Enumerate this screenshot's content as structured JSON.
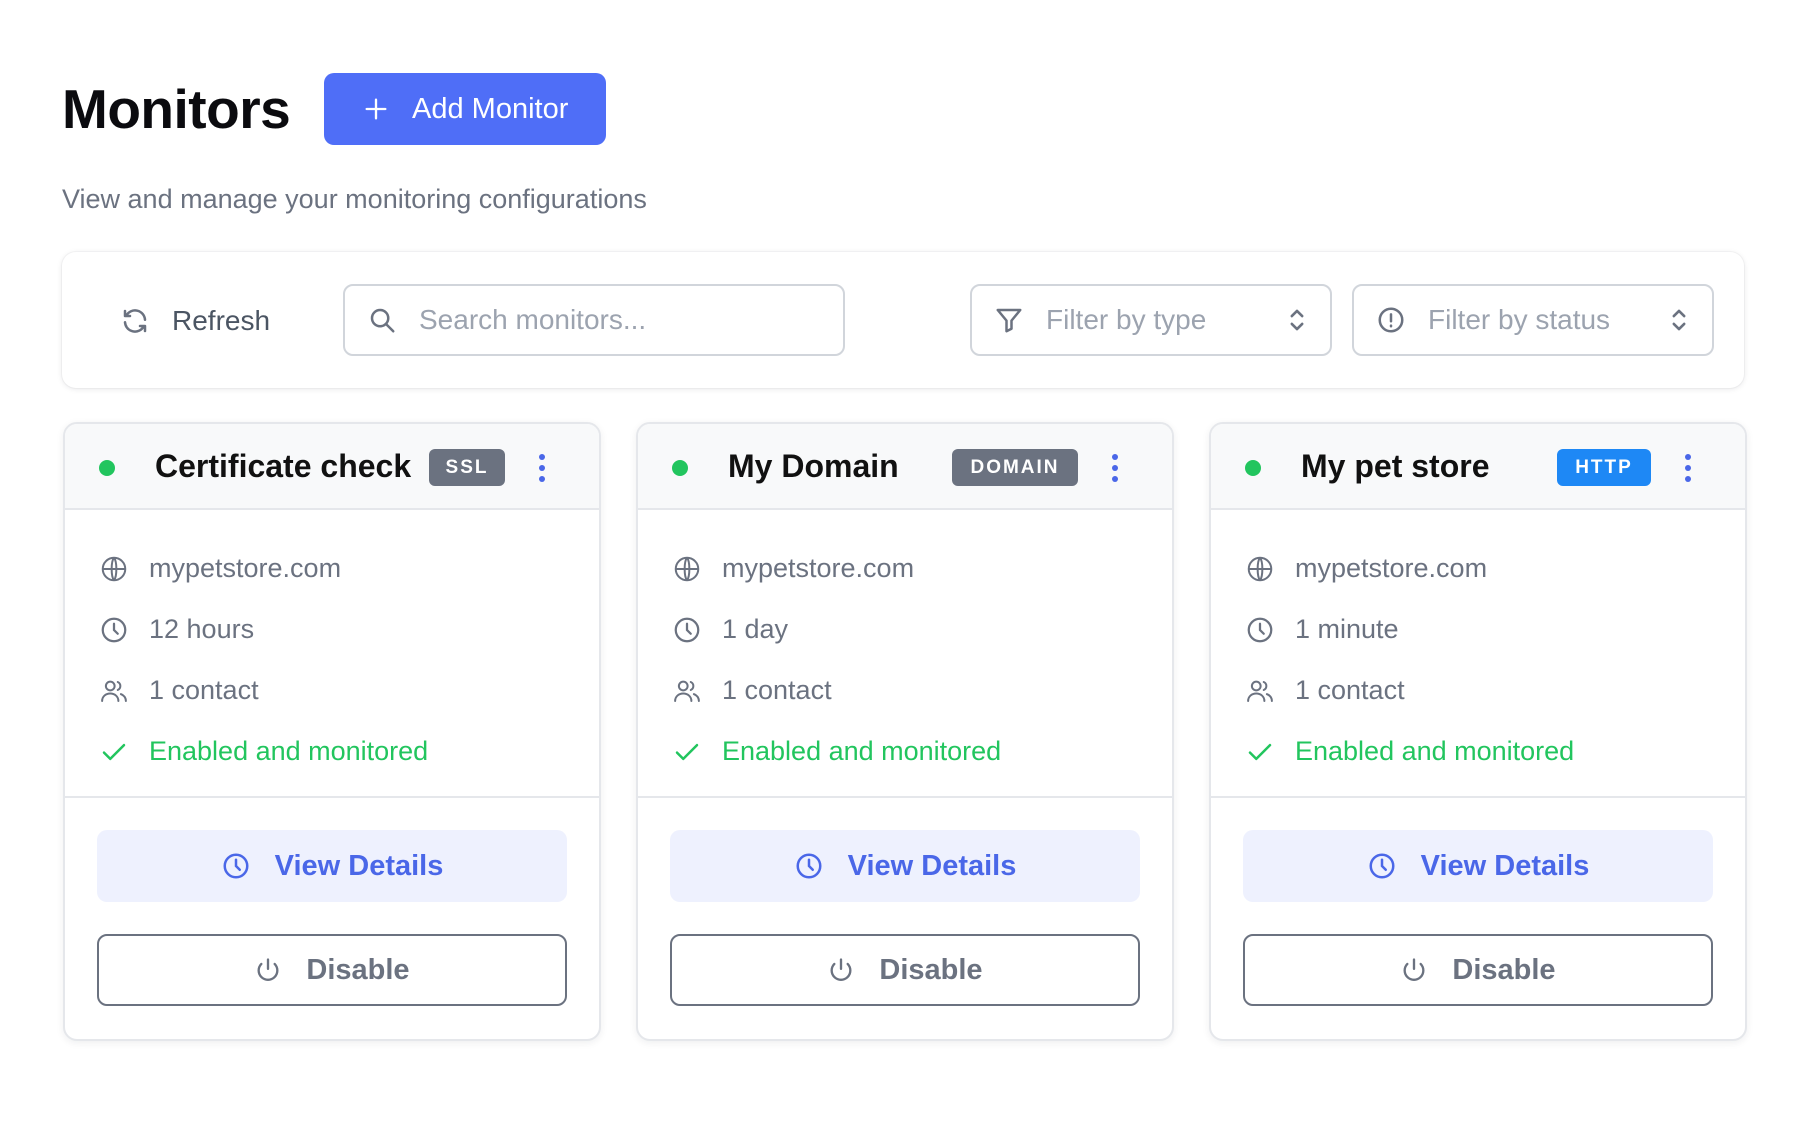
{
  "page": {
    "title": "Monitors",
    "subtitle": "View and manage your monitoring configurations",
    "add_label": "Add Monitor"
  },
  "toolbar": {
    "refresh_label": "Refresh",
    "search_placeholder": "Search monitors...",
    "filter_type_placeholder": "Filter by type",
    "filter_status_placeholder": "Filter by status"
  },
  "colors": {
    "accent": "#4f6ef7",
    "success": "#22c55e",
    "badge_ssl": "#6b7280",
    "badge_domain": "#6b7280",
    "badge_http": "#1e88f5"
  },
  "monitors": [
    {
      "name": "Certificate check",
      "type": "SSL",
      "host": "mypetstore.com",
      "interval": "12 hours",
      "contacts": "1 contact",
      "status": "Enabled and monitored",
      "view_label": "View Details",
      "disable_label": "Disable"
    },
    {
      "name": "My Domain",
      "type": "DOMAIN",
      "host": "mypetstore.com",
      "interval": "1 day",
      "contacts": "1 contact",
      "status": "Enabled and monitored",
      "view_label": "View Details",
      "disable_label": "Disable"
    },
    {
      "name": "My pet store",
      "type": "HTTP",
      "host": "mypetstore.com",
      "interval": "1 minute",
      "contacts": "1 contact",
      "status": "Enabled and monitored",
      "view_label": "View Details",
      "disable_label": "Disable"
    }
  ]
}
